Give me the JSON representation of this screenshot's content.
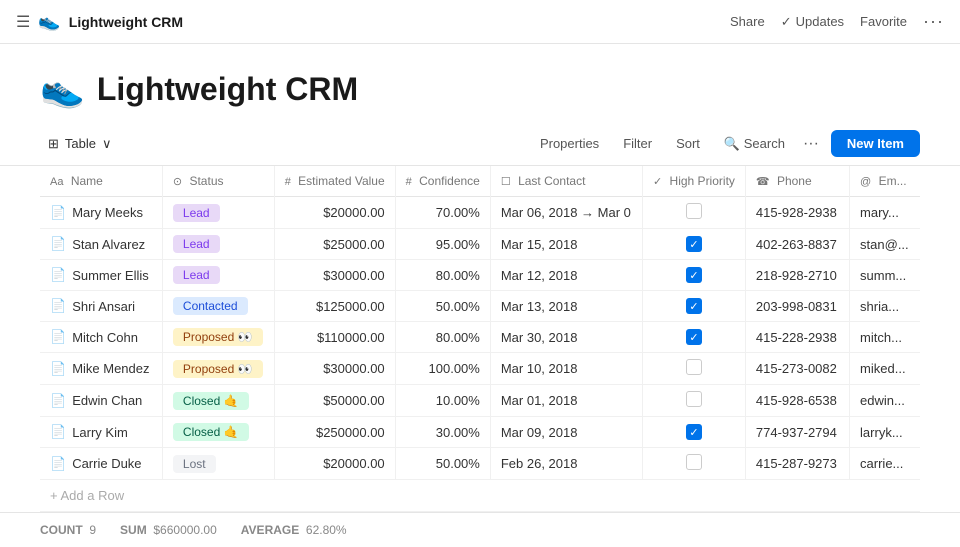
{
  "app": {
    "icon": "👟",
    "title": "Lightweight CRM",
    "nav": {
      "share": "Share",
      "updates": "Updates",
      "favorite": "Favorite",
      "more": "···"
    }
  },
  "page": {
    "icon": "👟",
    "title": "Lightweight CRM"
  },
  "toolbar": {
    "view_icon": "⊞",
    "view_label": "Table",
    "view_caret": "∨",
    "properties": "Properties",
    "filter": "Filter",
    "sort": "Sort",
    "search_icon": "🔍",
    "search": "Search",
    "more": "···",
    "new_item": "New Item"
  },
  "columns": [
    {
      "icon": "Aa",
      "label": "Name"
    },
    {
      "icon": "⊙",
      "label": "Status"
    },
    {
      "icon": "#",
      "label": "Estimated Value"
    },
    {
      "icon": "#",
      "label": "Confidence"
    },
    {
      "icon": "☐",
      "label": "Last Contact"
    },
    {
      "icon": "✓",
      "label": "High Priority"
    },
    {
      "icon": "☎",
      "label": "Phone"
    },
    {
      "icon": "@",
      "label": "Em..."
    }
  ],
  "rows": [
    {
      "name": "Mary Meeks",
      "status": "Lead",
      "status_type": "lead",
      "value": "$20000.00",
      "confidence": "70.00%",
      "contact": "Mar 06, 2018 → Mar 0",
      "priority": false,
      "phone": "415-928-2938",
      "email": "mary..."
    },
    {
      "name": "Stan Alvarez",
      "status": "Lead",
      "status_type": "lead",
      "value": "$25000.00",
      "confidence": "95.00%",
      "contact": "Mar 15, 2018",
      "priority": true,
      "phone": "402-263-8837",
      "email": "stan@..."
    },
    {
      "name": "Summer Ellis",
      "status": "Lead",
      "status_type": "lead",
      "value": "$30000.00",
      "confidence": "80.00%",
      "contact": "Mar 12, 2018",
      "priority": true,
      "phone": "218-928-2710",
      "email": "summ..."
    },
    {
      "name": "Shri Ansari",
      "status": "Contacted",
      "status_type": "contacted",
      "value": "$125000.00",
      "confidence": "50.00%",
      "contact": "Mar 13, 2018",
      "priority": true,
      "phone": "203-998-0831",
      "email": "shria..."
    },
    {
      "name": "Mitch Cohn",
      "status": "Proposed 👀",
      "status_type": "proposed",
      "value": "$110000.00",
      "confidence": "80.00%",
      "contact": "Mar 30, 2018",
      "priority": true,
      "phone": "415-228-2938",
      "email": "mitch..."
    },
    {
      "name": "Mike Mendez",
      "status": "Proposed 👀",
      "status_type": "proposed",
      "value": "$30000.00",
      "confidence": "100.00%",
      "contact": "Mar 10, 2018",
      "priority": false,
      "phone": "415-273-0082",
      "email": "miked..."
    },
    {
      "name": "Edwin Chan",
      "status": "Closed 🤙",
      "status_type": "closed",
      "value": "$50000.00",
      "confidence": "10.00%",
      "contact": "Mar 01, 2018",
      "priority": false,
      "phone": "415-928-6538",
      "email": "edwin..."
    },
    {
      "name": "Larry Kim",
      "status": "Closed 🤙",
      "status_type": "closed",
      "value": "$250000.00",
      "confidence": "30.00%",
      "contact": "Mar 09, 2018",
      "priority": true,
      "phone": "774-937-2794",
      "email": "larryk..."
    },
    {
      "name": "Carrie Duke",
      "status": "Lost",
      "status_type": "lost",
      "value": "$20000.00",
      "confidence": "50.00%",
      "contact": "Feb 26, 2018",
      "priority": false,
      "phone": "415-287-9273",
      "email": "carrie..."
    }
  ],
  "add_row": "+ Add a Row",
  "footer": {
    "count_label": "COUNT",
    "count": "9",
    "sum_label": "SUM",
    "sum": "$660000.00",
    "average_label": "AVERAGE",
    "average": "62.80%"
  }
}
